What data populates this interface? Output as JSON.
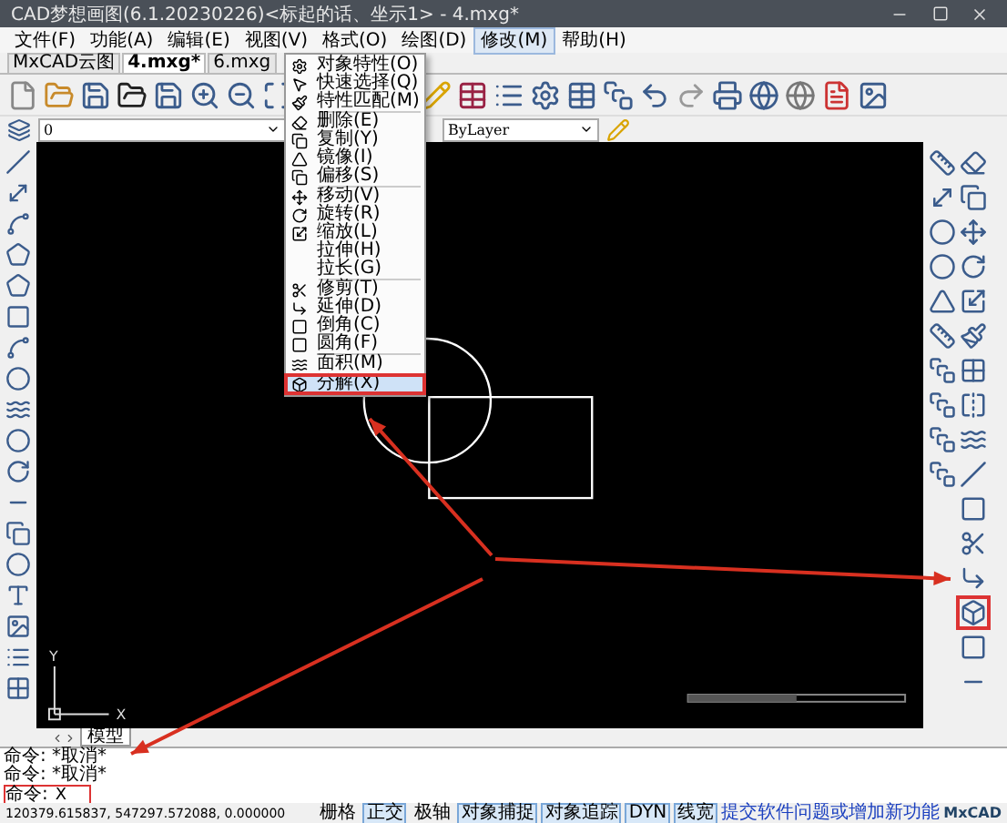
{
  "window": {
    "title": "CAD梦想画图(6.1.20230226)<标起的话、坐示1> - 4.mxg*"
  },
  "menubar": [
    {
      "label": "文件(F)",
      "selected": false
    },
    {
      "label": "功能(A)",
      "selected": false
    },
    {
      "label": "编辑(E)",
      "selected": false
    },
    {
      "label": "视图(V)",
      "selected": false
    },
    {
      "label": "格式(O)",
      "selected": false
    },
    {
      "label": "绘图(D)",
      "selected": false
    },
    {
      "label": "修改(M)",
      "selected": true
    },
    {
      "label": "帮助(H)",
      "selected": false
    }
  ],
  "menu": {
    "groups": [
      [
        {
          "label": "对象特性(O)",
          "selected": false
        },
        {
          "label": "快速选择(Q)",
          "selected": false
        },
        {
          "label": "特性匹配(M)",
          "selected": false
        }
      ],
      [
        {
          "label": "删除(E)",
          "selected": false
        },
        {
          "label": "复制(Y)",
          "selected": false
        },
        {
          "label": "镜像(I)",
          "selected": false
        },
        {
          "label": "偏移(S)",
          "selected": false
        }
      ],
      [
        {
          "label": "移动(V)",
          "selected": false
        },
        {
          "label": "旋转(R)",
          "selected": false
        },
        {
          "label": "缩放(L)",
          "selected": false
        },
        {
          "label": "拉伸(H)",
          "selected": false
        },
        {
          "label": "拉长(G)",
          "selected": false
        }
      ],
      [
        {
          "label": "修剪(T)",
          "selected": false
        },
        {
          "label": "延伸(D)",
          "selected": false
        },
        {
          "label": "倒角(C)",
          "selected": false
        },
        {
          "label": "圆角(F)",
          "selected": false
        }
      ],
      [
        {
          "label": "面积(M)",
          "selected": false
        }
      ],
      [
        {
          "label": "分解(X)",
          "selected": true
        }
      ]
    ]
  },
  "doc_tabs": [
    {
      "label": "MxCAD云图",
      "selected": false
    },
    {
      "label": "4.mxg*",
      "selected": true
    },
    {
      "label": "6.mxg",
      "selected": false
    }
  ],
  "layer": {
    "value": "0"
  },
  "linetype": {
    "value": "ByLayer"
  },
  "ucs": {
    "x": "X",
    "y": "Y"
  },
  "model_tabs": [
    {
      "label": "模型",
      "selected": true
    }
  ],
  "command": {
    "history": [
      "命令:  *取消*",
      "命令:  *取消*"
    ],
    "prompt": "命令:",
    "value": "X"
  },
  "status": {
    "coords": "120379.615837,  547297.572088,  0.000000",
    "toggles": [
      {
        "label": "栅格",
        "on": false
      },
      {
        "label": "正交",
        "on": true
      },
      {
        "label": "极轴",
        "on": false
      },
      {
        "label": "对象捕捉",
        "on": true
      },
      {
        "label": "对象追踪",
        "on": true
      },
      {
        "label": "DYN",
        "on": true
      },
      {
        "label": "线宽",
        "on": true
      }
    ],
    "link": "提交软件问题或增加新功能",
    "brand": "MxCAD"
  }
}
